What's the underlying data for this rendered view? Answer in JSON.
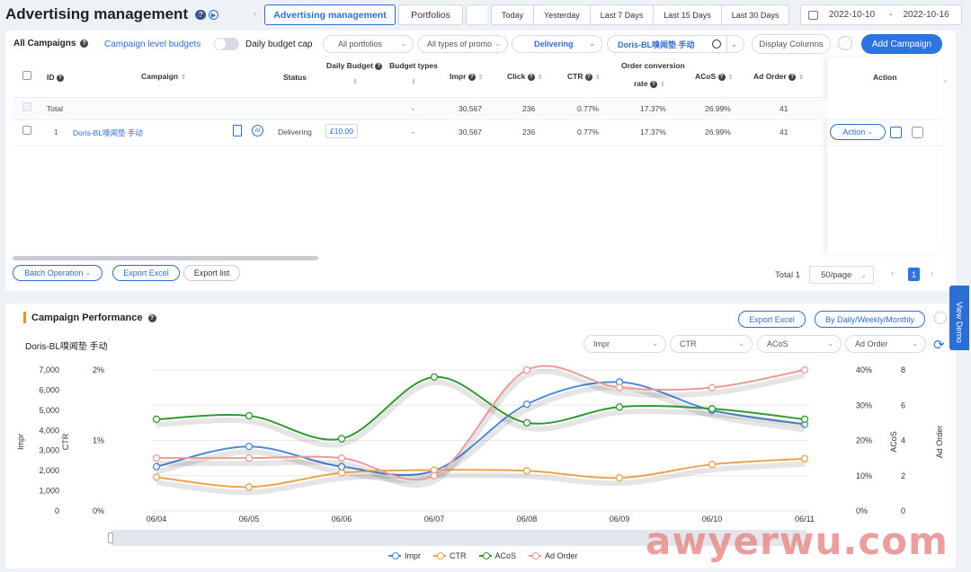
{
  "header": {
    "title": "Advertising management",
    "tabs": [
      {
        "label": "Advertising management",
        "active": true
      },
      {
        "label": "Portfolios",
        "active": false
      }
    ],
    "date_presets": [
      "Today",
      "Yesterday",
      "Last 7 Days",
      "Last 15 Days",
      "Last 30 Days"
    ],
    "date_start": "2022-10-10",
    "date_sep": "-",
    "date_end": "2022-10-16"
  },
  "campaigns": {
    "title": "All Campaigns",
    "toggle1_label": "Campaign level budgets",
    "toggle2_label": "Daily budget cap",
    "filters": {
      "portfolios": "All portfolios",
      "types": "All types of promo",
      "status": "Delivering",
      "search": "Doris-BL嗅闻垫 手动"
    },
    "display_columns": "Display Columns",
    "add_campaign": "Add Campaign",
    "columns": {
      "id": "ID",
      "campaign": "Campaign",
      "status": "Status",
      "daily_budget": "Daily Budget",
      "budget_types": "Budget types",
      "impr": "Impr",
      "click": "Click",
      "ctr": "CTR",
      "ocr_line1": "Order conversion",
      "ocr_line2": "rate",
      "acos": "ACoS",
      "ad_order": "Ad Order",
      "action": "Action"
    },
    "total_row": {
      "label": "Total",
      "budget_types": "-",
      "impr": "30,567",
      "click": "236",
      "ctr": "0.77%",
      "ocr": "17.37%",
      "acos": "26.99%",
      "ad_order": "41"
    },
    "rows": [
      {
        "id": "1",
        "campaign": "Doris-BL嗅闻垫 手动",
        "status": "Delivering",
        "daily_budget": "£10.00",
        "budget_types": "-",
        "impr": "30,567",
        "click": "236",
        "ctr": "0.77%",
        "ocr": "17.37%",
        "acos": "26.99%",
        "ad_order": "41",
        "action": "Action"
      }
    ],
    "footer": {
      "batch": "Batch Operation",
      "export_excel": "Export Excel",
      "export_list": "Export list",
      "total": "Total 1",
      "per_page": "50/page",
      "page": "1"
    }
  },
  "performance": {
    "title": "Campaign Performance",
    "export_excel": "Export Excel",
    "period": "By Daily/Weekly/Monthly",
    "campaign_name": "Doris-BL嗅闻垫 手动",
    "metric_selects": [
      "Impr",
      "CTR",
      "ACoS",
      "Ad Order"
    ]
  },
  "chart_data": {
    "type": "line",
    "x": [
      "06/04",
      "06/05",
      "06/06",
      "06/07",
      "06/08",
      "06/09",
      "06/10",
      "06/11"
    ],
    "series": [
      {
        "name": "Impr",
        "axis": "left1",
        "color": "#4a8ad8",
        "values": [
          2200,
          3200,
          2200,
          2000,
          5300,
          6400,
          5000,
          4300
        ]
      },
      {
        "name": "CTR",
        "axis": "left2",
        "color": "#e9a44c",
        "values": [
          0.0048,
          0.0034,
          0.0054,
          0.0058,
          0.0057,
          0.0047,
          0.0066,
          0.0074
        ]
      },
      {
        "name": "ACoS",
        "axis": "right1",
        "color": "#2f9a2f",
        "values": [
          0.26,
          0.27,
          0.205,
          0.38,
          0.25,
          0.295,
          0.29,
          0.26
        ]
      },
      {
        "name": "Ad Order",
        "axis": "right2",
        "color": "#ec9a96",
        "values": [
          3,
          3,
          3,
          2,
          8,
          7,
          7,
          8
        ]
      }
    ],
    "axes": {
      "left1": {
        "label": "Impr",
        "min": 0,
        "max": 7000,
        "ticks": [
          "0",
          "1,000",
          "2,000",
          "3,000",
          "4,000",
          "5,000",
          "6,000",
          "7,000"
        ]
      },
      "left2": {
        "label": "CTR",
        "min": 0,
        "max": 0.02,
        "ticks": [
          "0%",
          "1%",
          "2%"
        ]
      },
      "right1": {
        "label": "ACoS",
        "min": 0,
        "max": 0.4,
        "ticks": [
          "0%",
          "10%",
          "20%",
          "30%",
          "40%"
        ]
      },
      "right2": {
        "label": "Ad Order",
        "min": 0,
        "max": 8,
        "ticks": [
          "0",
          "2",
          "4",
          "6",
          "8"
        ]
      }
    },
    "legend": [
      "Impr",
      "CTR",
      "ACoS",
      "Ad Order"
    ],
    "legend_position": "bottom",
    "grid": true
  },
  "side": {
    "view_demo": "View Demo"
  },
  "watermark": "awyerwu.com",
  "colors": {
    "accent": "#2b6fd6",
    "orange_marker": "#f08c2a"
  }
}
